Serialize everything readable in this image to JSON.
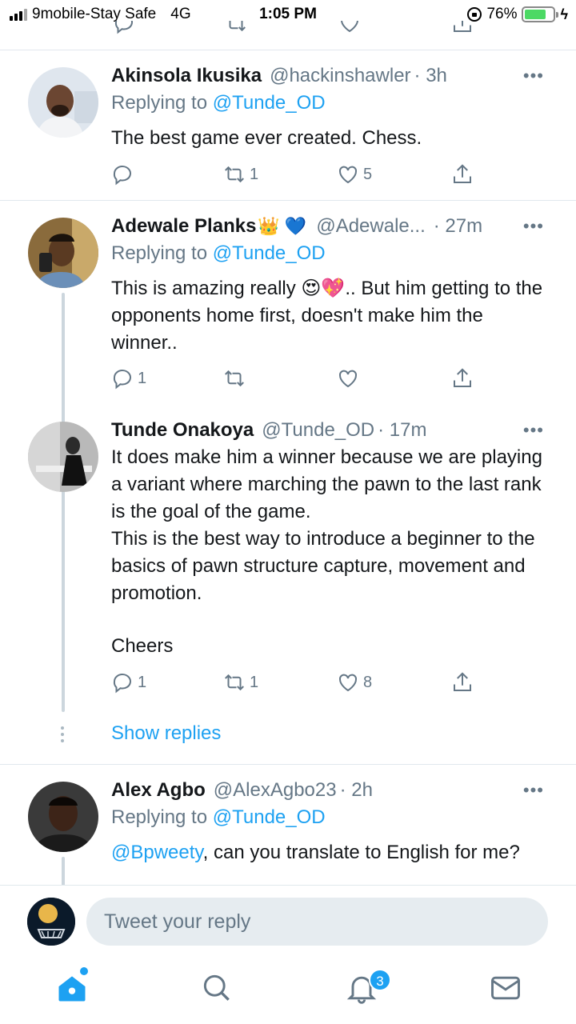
{
  "status_bar": {
    "carrier": "9mobile-Stay Safe",
    "network": "4G",
    "time": "1:05 PM",
    "battery": "76%",
    "battery_level": 0.76
  },
  "tweets": [
    {
      "name": "Akinsola Ikusika",
      "handle": "@hackinshawler",
      "time": "· 3h",
      "replying_prefix": "Replying to",
      "replying_to": "@Tunde_OD",
      "text": "The best game ever created. Chess.",
      "replies": "",
      "retweets": "1",
      "likes": "5"
    },
    {
      "name": "Adewale Planks",
      "name_emoji": "👑 💙",
      "handle": "@Adewale...",
      "time": "· 27m",
      "replying_prefix": "Replying to",
      "replying_to": "@Tunde_OD",
      "text_1": "This is amazing really 😍💖.. But him getting to the opponents home first, doesn't make him the winner..",
      "replies": "1",
      "retweets": "",
      "likes": ""
    },
    {
      "name": "Tunde Onakoya",
      "handle": "@Tunde_OD",
      "time": "· 17m",
      "text_1": "It does make him a winner because we are playing a variant where marching the pawn to the last rank is the goal of the game.",
      "text_2": "This is the best way to introduce a beginner to the basics of pawn structure capture, movement and promotion.",
      "text_3": "Cheers",
      "replies": "1",
      "retweets": "1",
      "likes": "8"
    },
    {
      "name": "Alex Agbo",
      "handle": "@AlexAgbo23",
      "time": "· 2h",
      "replying_prefix": "Replying to",
      "replying_to": "@Tunde_OD",
      "mention": "@Bpweety",
      "text_rest": ", can you translate to English for me?"
    }
  ],
  "show_replies": "Show replies",
  "reply_bar": {
    "placeholder": "Tweet your reply"
  },
  "tab_bar": {
    "notifications_badge": "3"
  },
  "icons": [
    "reply-icon",
    "retweet-icon",
    "like-icon",
    "share-icon",
    "more-icon",
    "home-icon",
    "search-icon",
    "notifications-icon",
    "messages-icon"
  ],
  "colors": {
    "accent": "#1da1f2",
    "secondary_text": "#657786",
    "divider": "#e1e8ed"
  }
}
